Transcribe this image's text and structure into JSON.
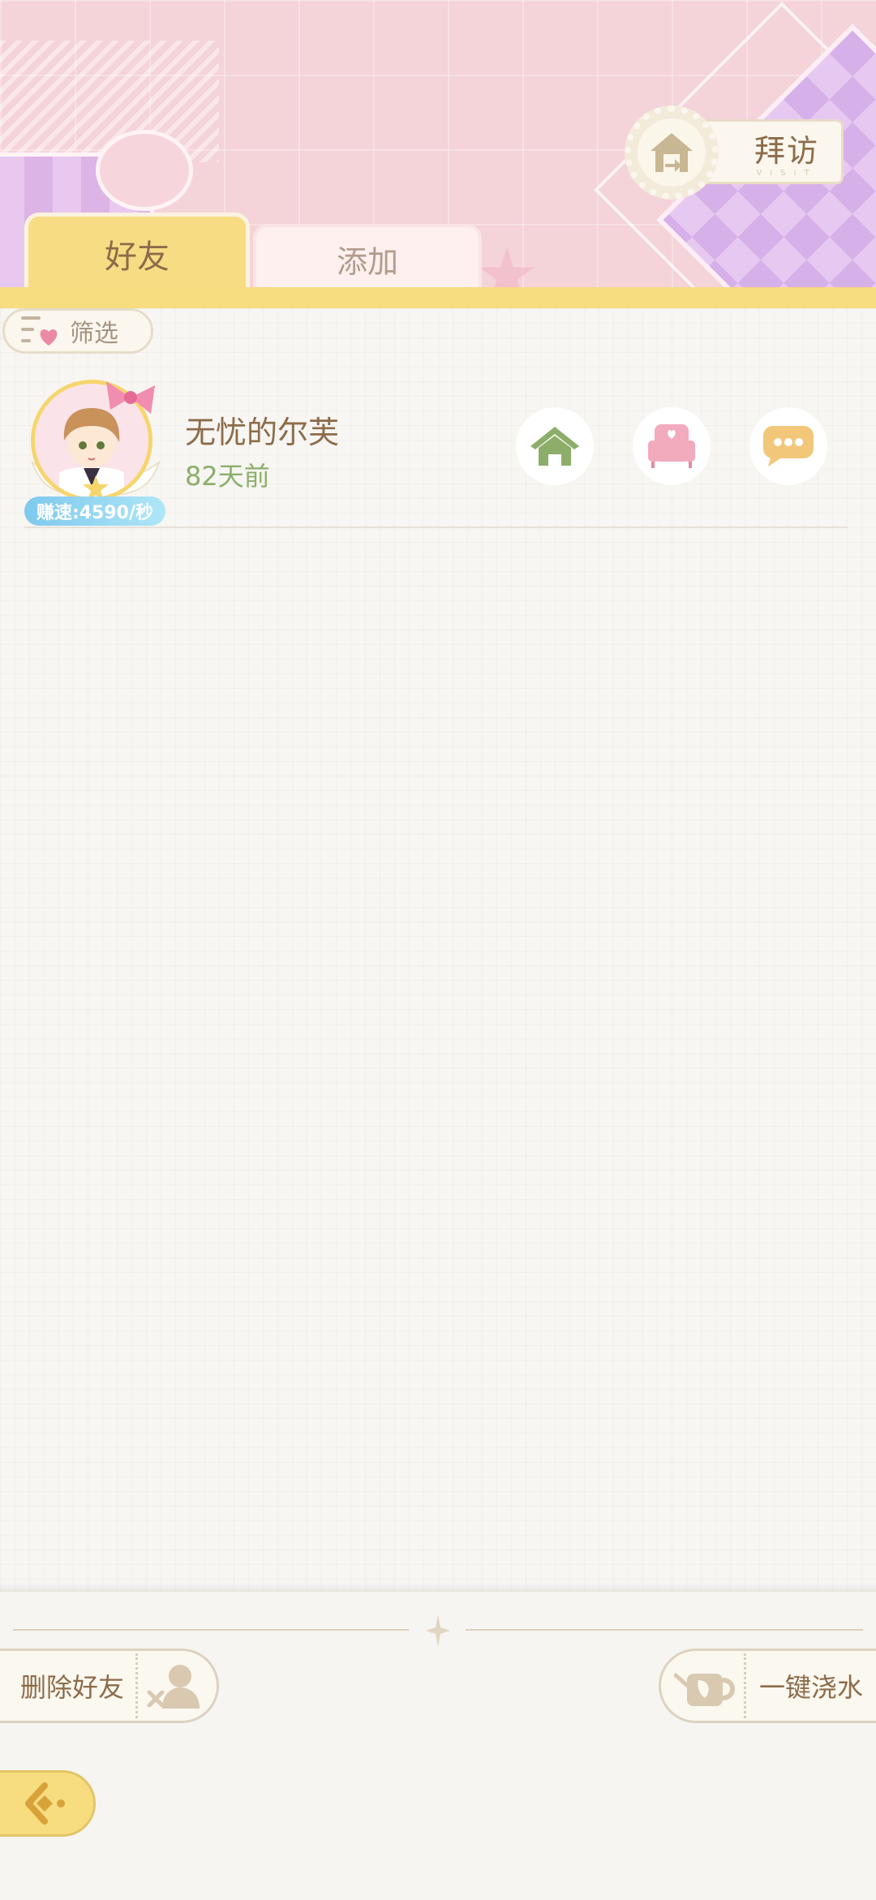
{
  "header": {
    "visit_button": {
      "label": "拜访",
      "sublabel": "VISIT",
      "icon": "house-return-icon"
    }
  },
  "tabs": [
    {
      "label": "好友",
      "active": true
    },
    {
      "label": "添加",
      "active": false
    }
  ],
  "filter": {
    "label": "筛选",
    "icon": "filter-heart-icon"
  },
  "friends": [
    {
      "name": "无忧的尔芙",
      "last_seen": "82天前",
      "speed_badge": "赚速:4590/秒",
      "actions": [
        "house-icon",
        "sofa-icon",
        "chat-bubble-icon"
      ]
    }
  ],
  "bottom": {
    "delete_friend_label": "删除好友",
    "water_all_label": "一键浇水",
    "back_icon": "back-arrow-icon"
  },
  "colors": {
    "accent_yellow": "#f7dc80",
    "text_brown": "#8c6c4a",
    "time_green": "#8dae6a",
    "header_pink": "#f4d3d9",
    "speed_blue": "#7ec9ee"
  }
}
